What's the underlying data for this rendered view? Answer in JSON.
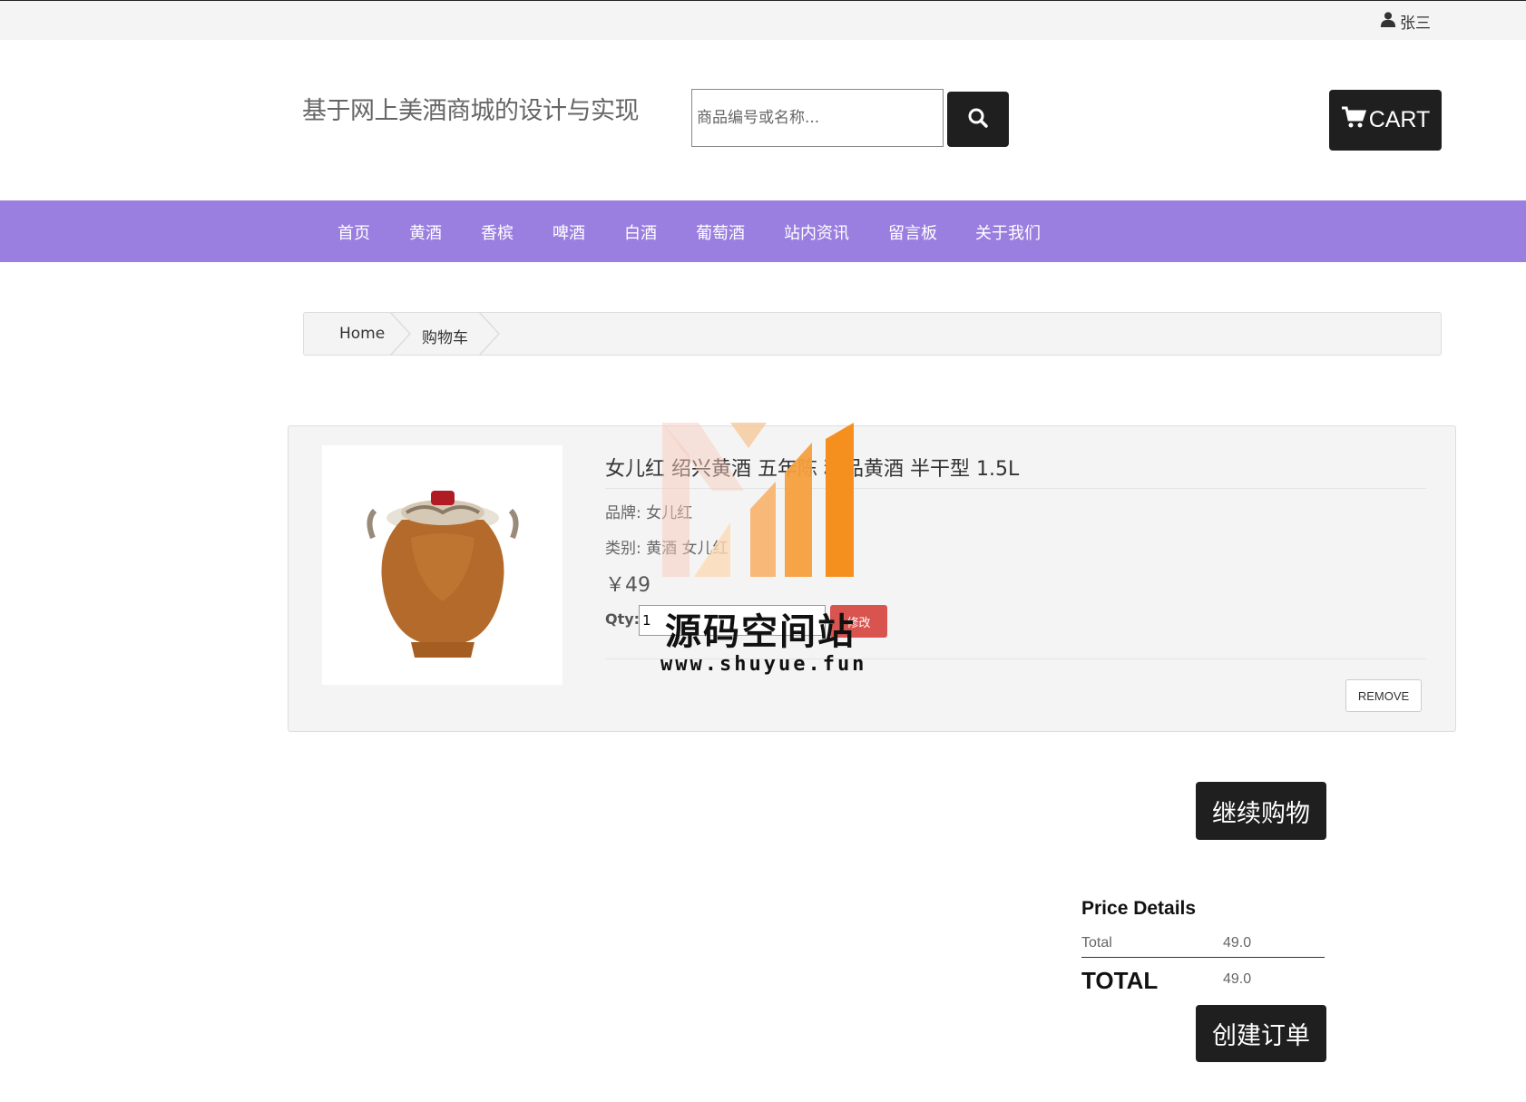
{
  "topbar": {
    "username": "张三",
    "user_icon": "user-icon"
  },
  "header": {
    "site_title": "基于网上美酒商城的设计与实现",
    "search_placeholder": "商品编号或名称...",
    "search_icon": "search-icon",
    "cart_label": "CART",
    "cart_icon": "cart-icon"
  },
  "nav": {
    "items": [
      {
        "label": "首页"
      },
      {
        "label": "黄酒"
      },
      {
        "label": "香槟"
      },
      {
        "label": "啤酒"
      },
      {
        "label": "白酒"
      },
      {
        "label": "葡萄酒"
      },
      {
        "label": "站内资讯"
      },
      {
        "label": "留言板"
      },
      {
        "label": "关于我们"
      }
    ]
  },
  "breadcrumb": {
    "items": [
      {
        "label": "Home"
      },
      {
        "label": "购物车"
      }
    ]
  },
  "cart_item": {
    "title": "女儿红 绍兴黄酒 五年陈 精品黄酒 半干型 1.5L",
    "brand": "品牌: 女儿红",
    "category": "类别: 黄酒 女儿红",
    "price": "￥49",
    "qty_label": "Qty:",
    "qty_value": "1",
    "update_label": "修改",
    "remove_label": "REMOVE"
  },
  "watermark": {
    "name": "源码空间站",
    "url": "www.shuyue.fun"
  },
  "actions": {
    "continue_label": "继续购物",
    "create_order_label": "创建订单"
  },
  "price_details": {
    "heading": "Price Details",
    "total_label": "Total",
    "total_value": "49.0",
    "grand_total_label": "TOTAL",
    "grand_total_value": "49.0"
  },
  "colors": {
    "nav_bg": "#9b7fe0",
    "button_dark": "#1f1f1f",
    "update_red": "#d9534f",
    "watermark_orange": "#f5901e"
  }
}
